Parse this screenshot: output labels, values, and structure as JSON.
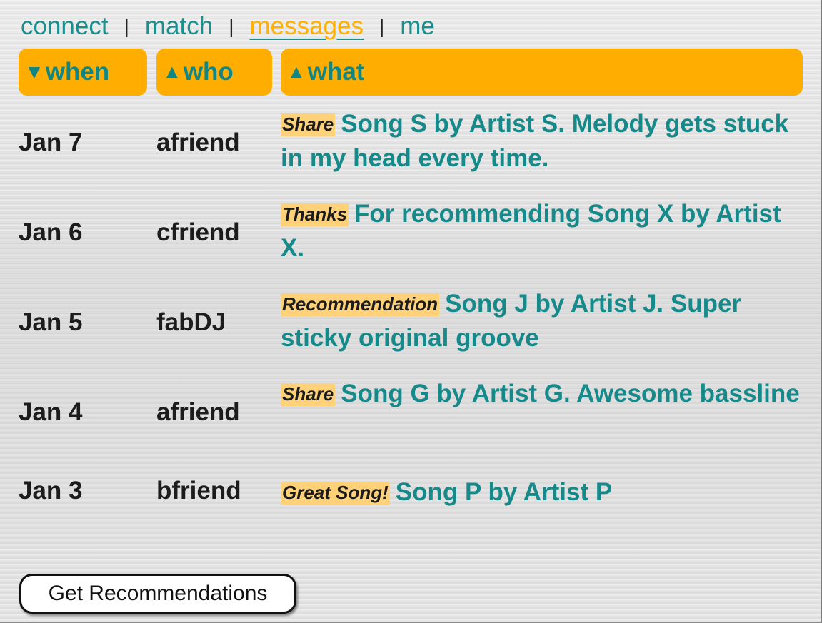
{
  "nav": {
    "items": [
      {
        "label": "connect"
      },
      {
        "label": "match"
      },
      {
        "label": "messages"
      },
      {
        "label": "me"
      }
    ],
    "separator": "|"
  },
  "headers": {
    "when": {
      "label": "when",
      "arrow": "▼"
    },
    "who": {
      "label": "who",
      "arrow": "▲"
    },
    "what": {
      "label": "what",
      "arrow": "▲"
    }
  },
  "messages": [
    {
      "date": "Jan 7",
      "who": "afriend",
      "tag": "Share",
      "text": "Song S by Artist S. Melody gets stuck in my head every time."
    },
    {
      "date": "Jan 6",
      "who": "cfriend",
      "tag": "Thanks",
      "text": "For recommending Song X by Artist X."
    },
    {
      "date": "Jan 5",
      "who": "fabDJ",
      "tag": "Recommendation",
      "text": "Song J by Artist J. Super sticky original groove"
    },
    {
      "date": "Jan 4",
      "who": "afriend",
      "tag": "Share",
      "text": "Song G by Artist G. Awesome bassline"
    },
    {
      "date": "Jan 3",
      "who": "bfriend",
      "tag": "Great Song!",
      "text": "Song P by Artist P"
    }
  ],
  "button": {
    "label": "Get Recommendations"
  },
  "colors": {
    "accent": "#ffae00",
    "teal": "#168a8a",
    "tag_bg": "#ffd27a",
    "text": "#1c1c1c"
  }
}
